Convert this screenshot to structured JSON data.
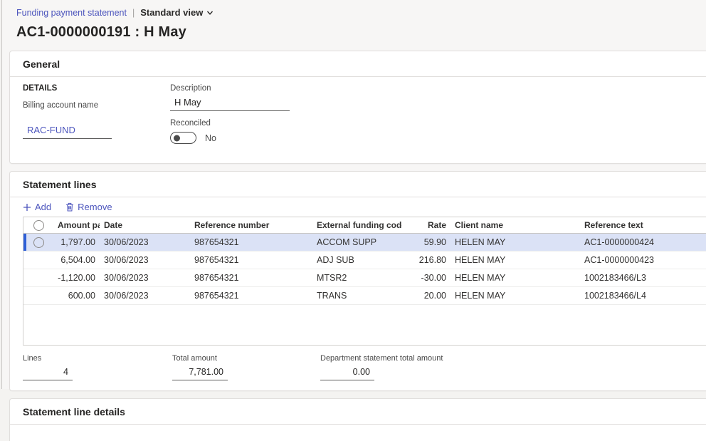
{
  "colors": {
    "accent": "#4c55bd",
    "selection_background": "#dbe2f6",
    "selection_bar": "#2e5fd7"
  },
  "breadcrumb": {
    "link": "Funding payment statement",
    "separator": "|",
    "view_name": "Standard view",
    "view_chevron_icon": "chevron-down-icon"
  },
  "page_title": "AC1-0000000191 : H May",
  "general": {
    "title": "General",
    "group_label": "DETAILS",
    "billing_account": {
      "label": "Billing account name",
      "value": "RAC-FUND"
    },
    "description": {
      "label": "Description",
      "value": "H May"
    },
    "reconciled": {
      "label": "Reconciled",
      "state": "No"
    }
  },
  "statement_lines": {
    "title": "Statement lines",
    "toolbar": {
      "add_label": "Add",
      "add_icon": "plus-icon",
      "remove_label": "Remove",
      "remove_icon": "trash-icon"
    },
    "columns": {
      "amount_paid": "Amount paid",
      "date": "Date",
      "reference_number": "Reference number",
      "external_funding_code": "External funding code",
      "rate": "Rate",
      "client_name": "Client name",
      "reference_text": "Reference text"
    },
    "rows": [
      {
        "selected": true,
        "amount_paid": "1,797.00",
        "date": "30/06/2023",
        "reference_number": "987654321",
        "external_funding_code": "ACCOM SUPP",
        "rate": "59.90",
        "client_name": "HELEN MAY",
        "reference_text": "AC1-0000000424"
      },
      {
        "selected": false,
        "amount_paid": "6,504.00",
        "date": "30/06/2023",
        "reference_number": "987654321",
        "external_funding_code": "ADJ SUB",
        "rate": "216.80",
        "client_name": "HELEN MAY",
        "reference_text": "AC1-0000000423"
      },
      {
        "selected": false,
        "amount_paid": "-1,120.00",
        "date": "30/06/2023",
        "reference_number": "987654321",
        "external_funding_code": "MTSR2",
        "rate": "-30.00",
        "client_name": "HELEN MAY",
        "reference_text": "1002183466/L3"
      },
      {
        "selected": false,
        "amount_paid": "600.00",
        "date": "30/06/2023",
        "reference_number": "987654321",
        "external_funding_code": "TRANS",
        "rate": "20.00",
        "client_name": "HELEN MAY",
        "reference_text": "1002183466/L4"
      }
    ],
    "totals": {
      "lines": {
        "label": "Lines",
        "value": "4"
      },
      "total_amount": {
        "label": "Total amount",
        "value": "7,781.00"
      },
      "department_total": {
        "label": "Department statement total amount",
        "value": "0.00"
      }
    }
  },
  "statement_line_details": {
    "title": "Statement line details"
  }
}
